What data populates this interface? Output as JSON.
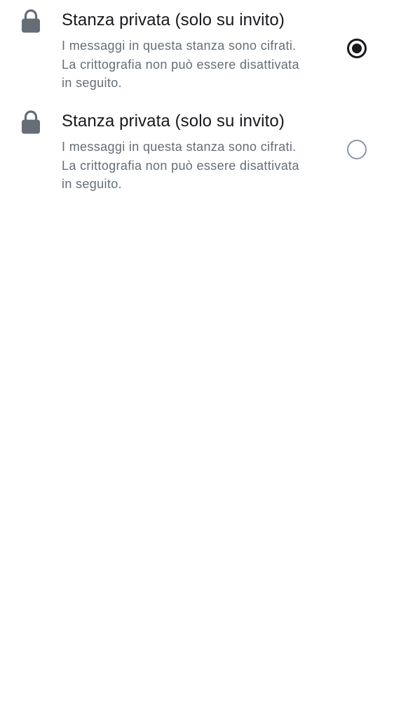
{
  "options": [
    {
      "icon": "lock-icon",
      "title": "Stanza privata (solo su invito)",
      "description_lines": [
        "I messaggi in questa stanza sono cifrati.",
        "La crittografia non può essere disattivata",
        "in seguito."
      ],
      "selected": true
    },
    {
      "icon": "lock-icon",
      "title": "Stanza privata (solo su invito)",
      "description_lines": [
        "I messaggi in questa stanza sono cifrati.",
        "La crittografia non può essere disattivata",
        "in seguito."
      ],
      "selected": false
    }
  ],
  "colors": {
    "title": "#17191c",
    "description": "#656d77",
    "icon": "#656d77",
    "radio_checked": "#17191c",
    "radio_unchecked": "#8d97a5"
  }
}
